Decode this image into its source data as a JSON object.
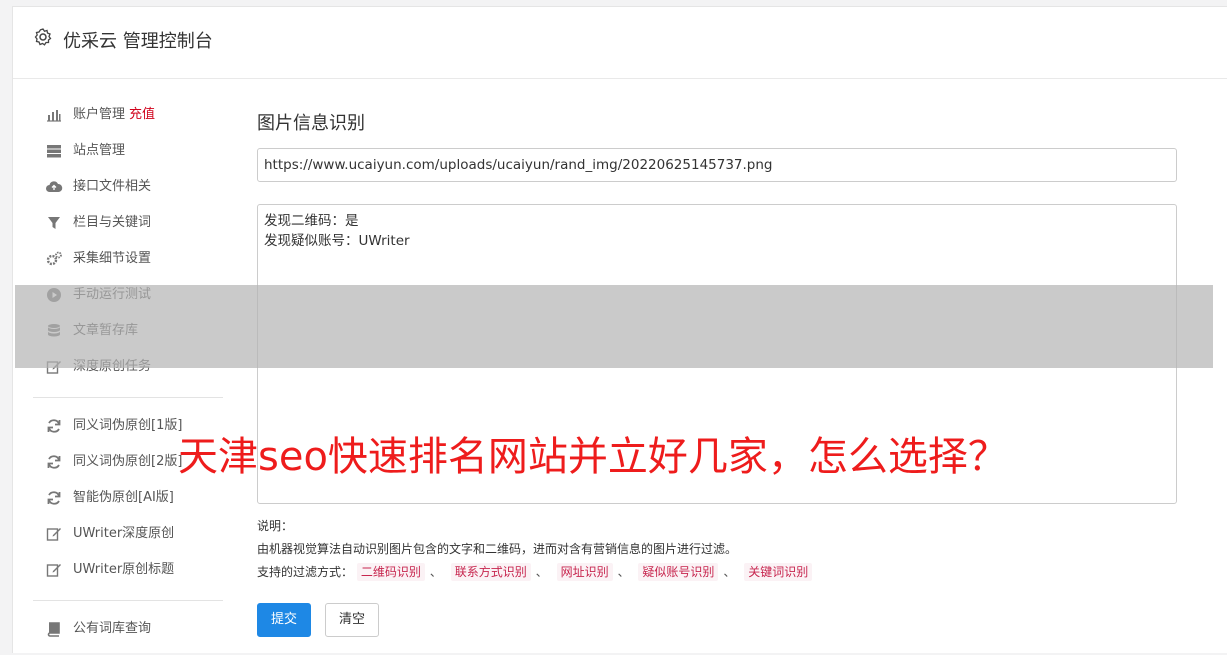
{
  "header": {
    "title": "优采云 管理控制台",
    "icon": "gear-icon"
  },
  "sidebar": {
    "group1": [
      {
        "icon": "bar-chart-icon",
        "label": "账户管理",
        "badge": "充值"
      },
      {
        "icon": "server-icon",
        "label": "站点管理"
      },
      {
        "icon": "cloud-upload-icon",
        "label": "接口文件相关"
      },
      {
        "icon": "filter-icon",
        "label": "栏目与关键词"
      },
      {
        "icon": "cogs-icon",
        "label": "采集细节设置"
      },
      {
        "icon": "play-circle-icon",
        "label": "手动运行测试"
      },
      {
        "icon": "database-icon",
        "label": "文章暂存库"
      },
      {
        "icon": "edit-icon",
        "label": "深度原创任务"
      }
    ],
    "group2": [
      {
        "icon": "refresh-icon",
        "label": "同义词伪原创[1版]"
      },
      {
        "icon": "refresh-icon",
        "label": "同义词伪原创[2版]"
      },
      {
        "icon": "refresh-icon",
        "label": "智能伪原创[AI版]"
      },
      {
        "icon": "edit-icon",
        "label": "UWriter深度原创"
      },
      {
        "icon": "edit-icon",
        "label": "UWriter原创标题"
      }
    ],
    "group3": [
      {
        "icon": "book-icon",
        "label": "公有词库查询"
      }
    ]
  },
  "main": {
    "title": "图片信息识别",
    "url_value": "https://www.ucaiyun.com/uploads/ucaiyun/rand_img/20220625145737.png",
    "result_lines": [
      "发现二维码：是",
      "发现疑似账号：UWriter"
    ],
    "note_label": "说明：",
    "note_text": "由机器视觉算法自动识别图片包含的文字和二维码，进而对含有营销信息的图片进行过滤。",
    "filter_label": "支持的过滤方式：",
    "filters": [
      "二维码识别",
      "联系方式识别",
      "网址识别",
      "疑似账号识别",
      "关键词识别"
    ],
    "filter_separator": "、",
    "submit_label": "提交",
    "clear_label": "清空"
  },
  "overlay": {
    "text": "天津seo快速排名网站并立好几家，怎么选择？"
  }
}
